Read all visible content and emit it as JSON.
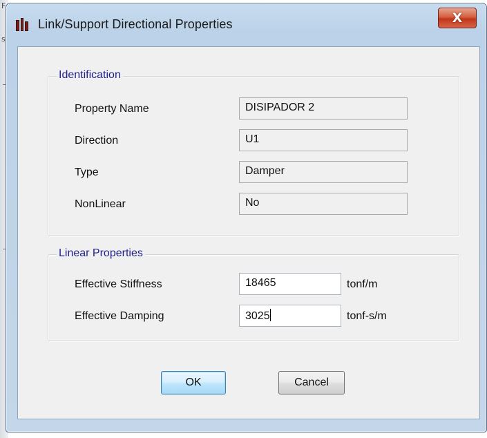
{
  "window": {
    "title": "Link/Support Directional Properties",
    "close_glyph": "X"
  },
  "identification": {
    "group_title": "Identification",
    "property_name_label": "Property Name",
    "property_name_value": "DISIPADOR 2",
    "direction_label": "Direction",
    "direction_value": "U1",
    "type_label": "Type",
    "type_value": "Damper",
    "nonlinear_label": "NonLinear",
    "nonlinear_value": "No"
  },
  "linear_properties": {
    "group_title": "Linear Properties",
    "stiffness_label": "Effective Stiffness",
    "stiffness_value": "18465",
    "stiffness_unit": "tonf/m",
    "damping_label": "Effective Damping",
    "damping_value": "3025",
    "damping_unit": "tonf-s/m"
  },
  "buttons": {
    "ok_label": "OK",
    "cancel_label": "Cancel"
  },
  "background": {
    "left_marks": [
      "F",
      "s"
    ]
  },
  "colors": {
    "group_title": "#1f1f8c",
    "close_button": "#c1371a",
    "title_bar": "#bcd2e8"
  },
  "icons": {
    "app_icon": "sap-app-icon",
    "close_icon": "close-icon"
  }
}
